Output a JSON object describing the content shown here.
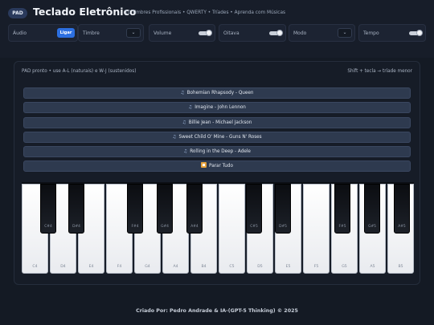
{
  "header": {
    "badge": "PAD",
    "title": "Teclado Eletrônico",
    "subtitle": "10 Timbres Profissionais • QWERTY • Tríades • Aprenda com Músicas"
  },
  "controls": {
    "audio": {
      "label": "Áudio",
      "button": "Ligar"
    },
    "timbre": {
      "label": "Timbre",
      "caret": "⌄"
    },
    "volume": {
      "label": "Volume"
    },
    "oitava": {
      "label": "Oitava"
    },
    "modo": {
      "label": "Modo",
      "caret": "⌄"
    },
    "tempo": {
      "label": "Tempo"
    }
  },
  "status": {
    "left": "PAD pronto • use A-L (naturais) e W-J (sustenidos)",
    "right": "Shift + tecla → tríade menor"
  },
  "songs": [
    "Bohemian Rhapsody - Queen",
    "Imagine - John Lennon",
    "Billie Jean - Michael Jackson",
    "Sweet Child O' Mine - Guns N' Roses",
    "Rolling in the Deep - Adele"
  ],
  "icons": {
    "song": "music-note-icon",
    "stop": "stop-icon"
  },
  "stop_button": "Parar Tudo",
  "keyboard": {
    "white_keys": [
      "C4",
      "D4",
      "E4",
      "F4",
      "G4",
      "A4",
      "B4",
      "C5",
      "D5",
      "E5",
      "F5",
      "G5",
      "A5",
      "B5"
    ],
    "black_keys": [
      "C#4",
      "D#4",
      "F#4",
      "G#4",
      "A#4",
      "C#5",
      "D#5",
      "F#5",
      "G#5",
      "A#5"
    ]
  },
  "footer": "Criado Por: Pedro Andrade & IA-(GPT-5 Thinking) © 2025",
  "colors": {
    "accent": "#2c6fe0",
    "background": "#141a24",
    "button": "#2e3a4f"
  }
}
